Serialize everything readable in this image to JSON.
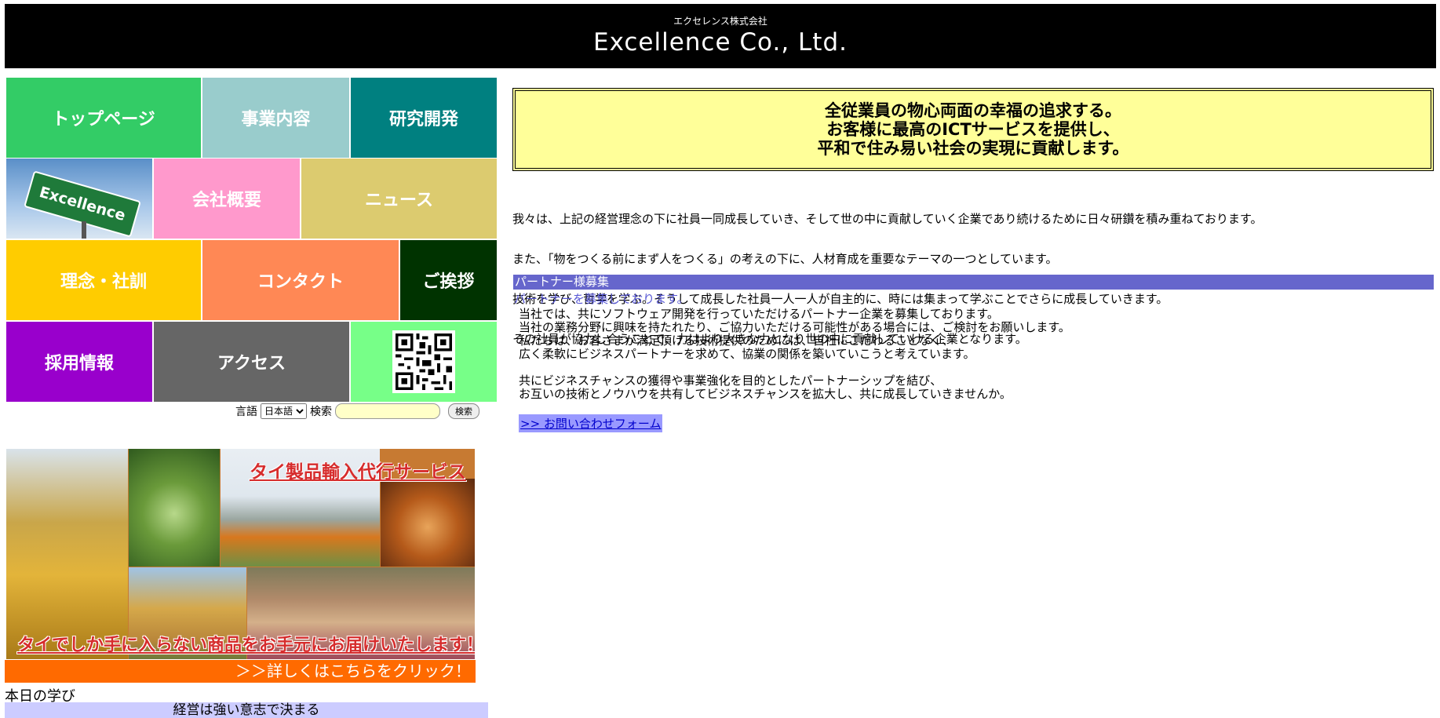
{
  "header": {
    "company_kana": "エクセレンス株式会社",
    "company_name": "Excellence Co., Ltd."
  },
  "nav": {
    "top": "トップページ",
    "business": "事業内容",
    "research": "研究開発",
    "excellence_image_text": "Excellence",
    "company": "会社概要",
    "news": "ニュース",
    "philosophy": "理念・社訓",
    "contact": "コンタクト",
    "greeting": "ご挨拶",
    "recruit": "採用情報",
    "access": "アクセス",
    "qr_icon": "qr-code-icon"
  },
  "search": {
    "lang_label": "言語",
    "lang_selected": "日本語",
    "search_label": "検索",
    "search_button": "検索",
    "search_value": ""
  },
  "banner": {
    "title": "タイ製品輸入代行サービス",
    "tagline": "タイでしか手に入らない商品をお手元にお届けいたします！",
    "click": "＞＞詳しくはこちらをクリック！"
  },
  "learning": {
    "label": "本日の学び",
    "headline": "経営は強い意志で決まる"
  },
  "philosophy": {
    "line1": "全従業員の物心両面の幸福の追求する。",
    "line2": "お客様に最高のICTサービスを提供し、",
    "line3": "平和で住み易い社会の実現に貢献します。"
  },
  "intro": {
    "line1": "  我々は、上記の経営理念の下に社員一同成長していき、そして世の中に貢献していく企業であり続けるために日々研鑽を積み重ねております。",
    "line2": "  また、「物をつくる前にまず人をつくる」の考えの下に、人材育成を重要なテーマの一つとしています。",
    "line3": "  技術を学び、哲学を学ぶ。そうして成長した社員一人一人が自主的に、時には集まって学ぶことでさらに成長していきます。",
    "line4": "その社員が協力し合うことで、力はより大きな力となり世の中に貢献していける企業となります。"
  },
  "partner": {
    "heading": "パートナー様募集",
    "subheading": "パートナーを募集しております。",
    "body1": "当社では、共にソフトウェア開発を行っていただけるパートナー企業を募集しております。",
    "body2": "当社の業務分野に興味を持たれたり、ご協力いただける可能性がある場合には、ご検討をお願いします。",
    "body3": "私たちは、お客さまが満足頂ける技術提供のためには、自社にこだわることなく、",
    "body4": "広く柔軟にビジネスパートナーを求めて、協業の関係を築いていこうと考えています。",
    "body5": "共にビジネスチャンスの獲得や事業強化を目的としたパートナーシップを結び、",
    "body6": "お互いの技術とノウハウを共有してビジネスチャンスを拡大し、共に成長していきませんか。",
    "contact_link": ">> お問い合わせフォーム"
  },
  "colors": {
    "top": "#33cc66",
    "business": "#99cccc",
    "research": "#008080",
    "company": "#ff99cc",
    "news": "#dccb6f",
    "philosophy": "#ffcc00",
    "contact": "#ff8855",
    "greeting": "#003300",
    "recruit": "#9900cc",
    "access": "#666666",
    "qr_bg": "#77ff88"
  }
}
